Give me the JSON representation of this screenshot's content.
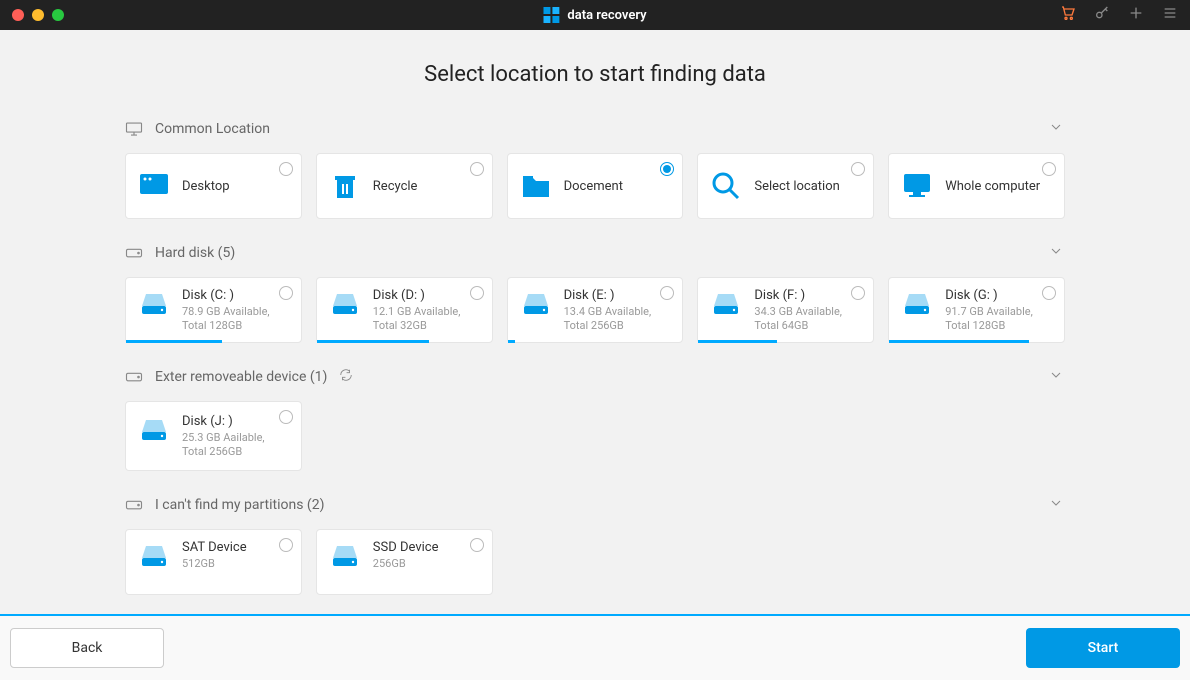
{
  "app": {
    "title": "data recovery"
  },
  "page": {
    "title": "Select location to  start finding data"
  },
  "sections": {
    "common": {
      "label": "Common Location",
      "items": [
        {
          "label": "Desktop",
          "selected": false
        },
        {
          "label": "Recycle",
          "selected": false
        },
        {
          "label": "Docement",
          "selected": true
        },
        {
          "label": "Select location",
          "selected": false
        },
        {
          "label": "Whole computer",
          "selected": false
        }
      ]
    },
    "hard": {
      "label": "Hard disk (5)",
      "items": [
        {
          "label": "Disk (C: )",
          "sub": "78.9 GB Available, Total 128GB",
          "usage": 55
        },
        {
          "label": "Disk (D: )",
          "sub": "12.1 GB Available, Total 32GB",
          "usage": 64
        },
        {
          "label": "Disk (E: )",
          "sub": "13.4 GB Available, Total 256GB",
          "usage": 4
        },
        {
          "label": "Disk (F: )",
          "sub": "34.3 GB Available, Total 64GB",
          "usage": 45
        },
        {
          "label": "Disk (G: )",
          "sub": "91.7 GB Available, Total 128GB",
          "usage": 80
        }
      ]
    },
    "ext": {
      "label": "Exter removeable device (1)",
      "items": [
        {
          "label": "Disk (J: )",
          "sub": "25.3 GB Aailable, Total 256GB"
        }
      ]
    },
    "partitions": {
      "label": "I can't find my partitions (2)",
      "items": [
        {
          "label": "SAT Device",
          "sub": "512GB"
        },
        {
          "label": "SSD Device",
          "sub": "256GB"
        }
      ]
    }
  },
  "footer": {
    "back": "Back",
    "start": "Start"
  },
  "colors": {
    "accent": "#0099e5",
    "accentLight": "#00aaff"
  }
}
